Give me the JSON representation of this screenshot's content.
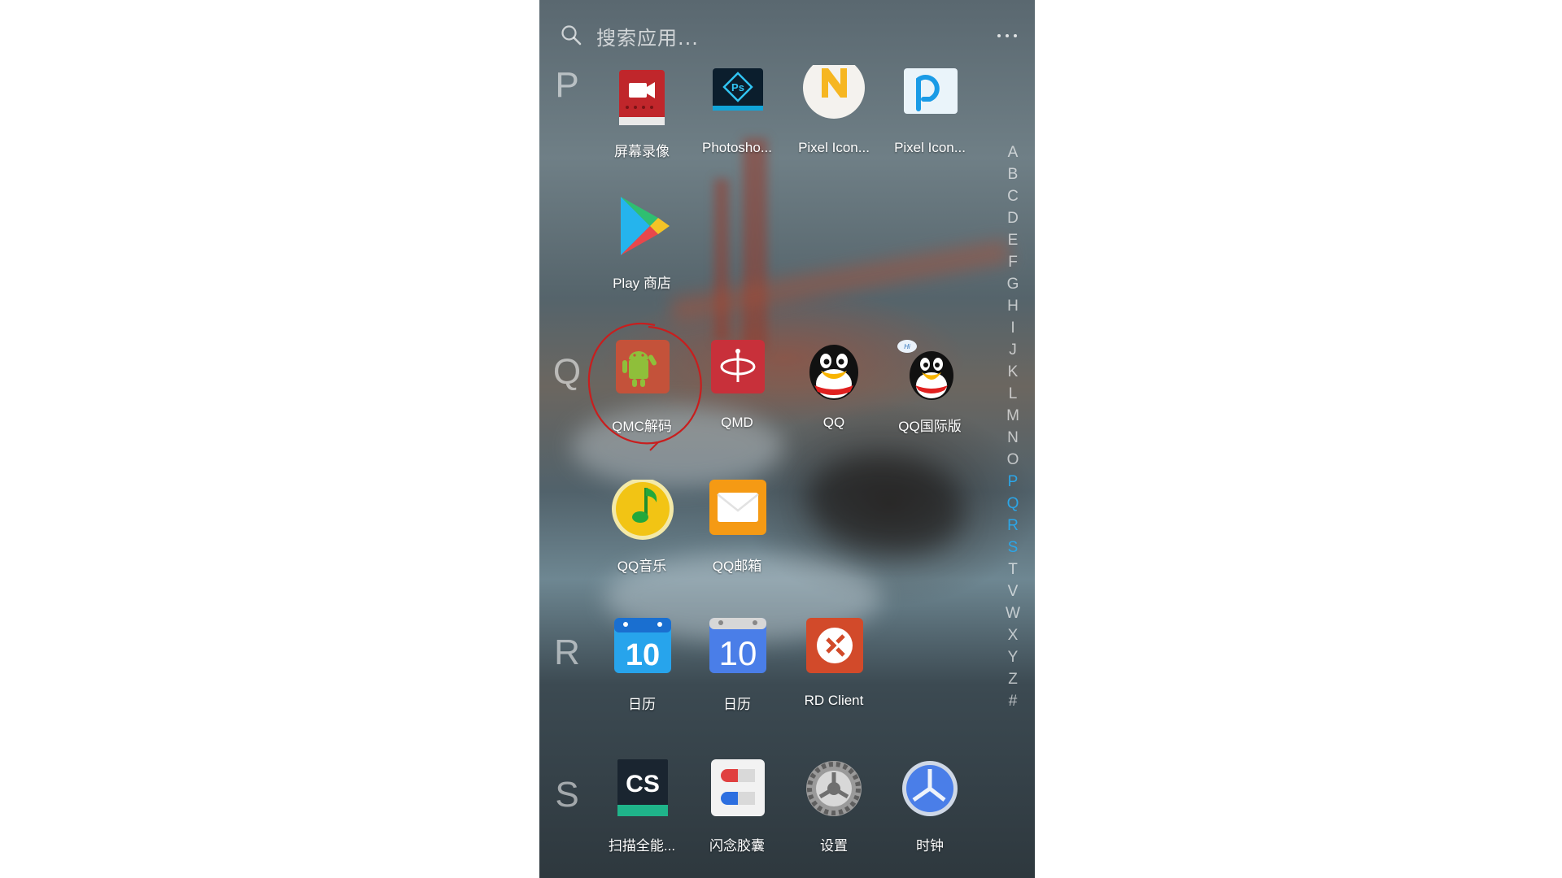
{
  "search": {
    "placeholder": "搜索应用..."
  },
  "sections": [
    {
      "letter": "P"
    },
    {
      "letter": "Q"
    },
    {
      "letter": "R"
    },
    {
      "letter": "S"
    }
  ],
  "apps": [
    {
      "label": "屏幕录像",
      "icon": "screen-recorder-icon"
    },
    {
      "label": "Photosho...",
      "icon": "photoshop-icon"
    },
    {
      "label": "Pixel Icon...",
      "icon": "pixel-icon-n-icon"
    },
    {
      "label": "Pixel Icon...",
      "icon": "pixel-icon-p-icon"
    },
    {
      "label": "Play 商店",
      "icon": "play-store-icon"
    },
    {
      "label": "QMC解码",
      "icon": "qmc-decoder-icon"
    },
    {
      "label": "QMD",
      "icon": "qmd-icon"
    },
    {
      "label": "QQ",
      "icon": "qq-penguin-icon"
    },
    {
      "label": "QQ国际版",
      "icon": "qq-international-icon"
    },
    {
      "label": "QQ音乐",
      "icon": "qq-music-icon"
    },
    {
      "label": "QQ邮箱",
      "icon": "qq-mail-icon"
    },
    {
      "label": "日历",
      "icon": "calendar-icon",
      "date": "10"
    },
    {
      "label": "日历",
      "icon": "google-calendar-icon",
      "date": "10"
    },
    {
      "label": "RD Client",
      "icon": "rd-client-icon"
    },
    {
      "label": "扫描全能...",
      "icon": "camscanner-icon",
      "text": "CS"
    },
    {
      "label": "闪念胶囊",
      "icon": "flash-capsule-icon"
    },
    {
      "label": "设置",
      "icon": "settings-gear-icon"
    },
    {
      "label": "时钟",
      "icon": "clock-icon"
    }
  ],
  "index_letters": [
    "A",
    "B",
    "C",
    "D",
    "E",
    "F",
    "G",
    "H",
    "I",
    "J",
    "K",
    "L",
    "M",
    "N",
    "O",
    "P",
    "Q",
    "R",
    "S",
    "T",
    "V",
    "W",
    "X",
    "Y",
    "Z",
    "#"
  ],
  "index_active": [
    "P",
    "Q",
    "R",
    "S"
  ],
  "colors": {
    "accent": "#2ba6e8",
    "annotation": "#c81e1e"
  }
}
